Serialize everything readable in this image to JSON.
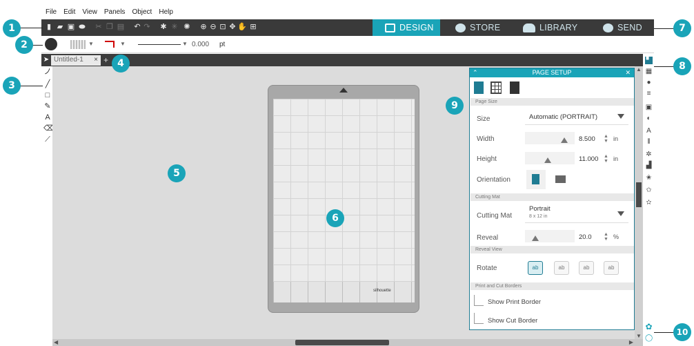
{
  "menu": [
    "File",
    "Edit",
    "View",
    "Panels",
    "Object",
    "Help"
  ],
  "nav_tabs": [
    {
      "label": "DESIGN",
      "icon": "design-grid-icon",
      "active": true
    },
    {
      "label": "STORE",
      "icon": "store-icon",
      "active": false
    },
    {
      "label": "LIBRARY",
      "icon": "cloud-library-icon",
      "active": false
    },
    {
      "label": "SEND",
      "icon": "send-check-icon",
      "active": false
    }
  ],
  "line_options": {
    "weight": "0.000",
    "unit": "pt",
    "line_color": "#d00000"
  },
  "document": {
    "tab_label": "Untitled-1",
    "close": "×",
    "add": "+"
  },
  "page_setup": {
    "title": "PAGE SETUP",
    "sections": {
      "page_size": "Page Size",
      "cutting_mat": "Cutting Mat",
      "reveal_view": "Reveal View",
      "print_cut": "Print and Cut Borders"
    },
    "size_label": "Size",
    "size_value": "Automatic (PORTRAIT)",
    "width_label": "Width",
    "width_value": "8.500",
    "height_label": "Height",
    "height_value": "11.000",
    "unit": "in",
    "orientation_label": "Orientation",
    "cutting_mat_label": "Cutting Mat",
    "cutting_mat_value": "Portrait",
    "cutting_mat_sub": "8 x 12 in",
    "reveal_label": "Reveal",
    "reveal_value": "20.0",
    "reveal_unit": "%",
    "rotate_label": "Rotate",
    "rotate_options": [
      "ab",
      "ab",
      "ab",
      "ab"
    ],
    "show_print_border": "Show Print Border",
    "show_cut_border": "Show Cut Border"
  },
  "mat_logo": "silhouette",
  "callouts": [
    "1",
    "2",
    "3",
    "4",
    "5",
    "6",
    "7",
    "8",
    "9",
    "10"
  ],
  "colors": {
    "accent": "#1aa4b8",
    "toolbar": "#3a3a3a",
    "canvas": "#dcdcdc"
  }
}
